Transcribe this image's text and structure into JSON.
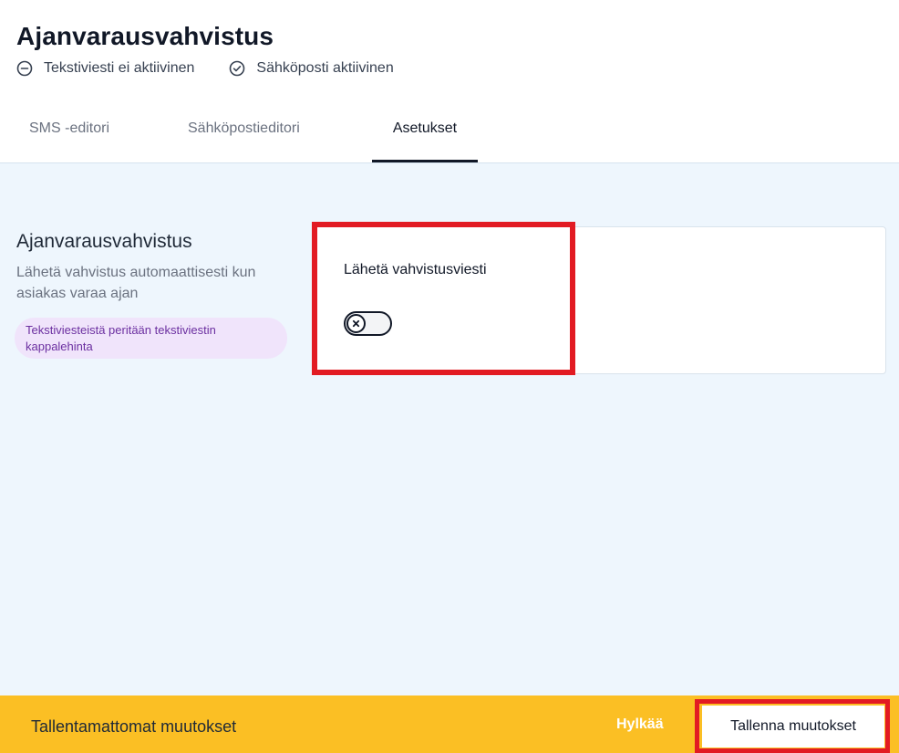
{
  "header": {
    "title": "Ajanvarausvahvistus",
    "status": [
      {
        "label": "Tekstiviesti ei aktiivinen",
        "icon": "minus-circle-icon"
      },
      {
        "label": "Sähköposti aktiivinen",
        "icon": "check-circle-icon"
      }
    ]
  },
  "tabs": [
    {
      "label": "SMS -editori",
      "active": false
    },
    {
      "label": "Sähköpostieditori",
      "active": false
    },
    {
      "label": "Asetukset",
      "active": true
    }
  ],
  "settings": {
    "section_title": "Ajanvarausvahvistus",
    "section_description": "Lähetä vahvistus automaattisesti kun asiakas varaa ajan",
    "pill_text": "Tekstiviesteistä peritään tekstiviestin kappalehinta",
    "card": {
      "label": "Lähetä vahvistusviesti",
      "toggle_on": false,
      "toggle_icon": "x-icon"
    }
  },
  "footer": {
    "text": "Tallentamattomat muutokset",
    "discard_label": "Hylkää",
    "save_label": "Tallenna muutokset"
  },
  "colors": {
    "footer_bg": "#fbbf24",
    "content_bg": "#eef6fd",
    "pill_bg": "#f0e4fb",
    "pill_text": "#6b2fa0",
    "highlight": "#e21b23"
  }
}
